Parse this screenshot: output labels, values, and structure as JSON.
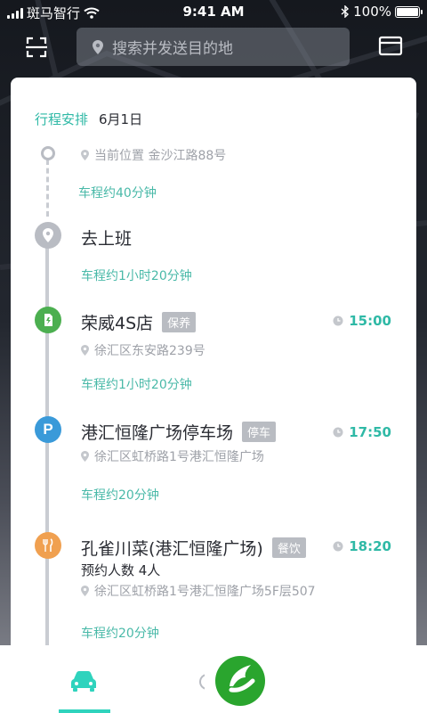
{
  "status_bar": {
    "carrier": "斑马智行",
    "time": "9:41 AM",
    "battery": "100%"
  },
  "search": {
    "placeholder": "搜索并发送目的地"
  },
  "schedule": {
    "label": "行程安排",
    "date": "6月1日",
    "start": {
      "location": "当前位置 金沙江路88号"
    },
    "travel_times": [
      "车程约40分钟",
      "车程约1小时20分钟",
      "车程约1小时20分钟",
      "车程约20分钟",
      "车程约20分钟"
    ],
    "stops": [
      {
        "name": "去上班",
        "icon": "location-pin-icon"
      },
      {
        "name": "荣威4S店",
        "tag": "保养",
        "time": "15:00",
        "address": "徐汇区东安路239号",
        "icon": "car-service-icon",
        "color": "#4caf50"
      },
      {
        "name": "港汇恒隆广场停车场",
        "tag": "停车",
        "time": "17:50",
        "address": "徐汇区虹桥路1号港汇恒隆广场",
        "icon": "parking-icon",
        "color": "#3a9ad9"
      },
      {
        "name": "孔雀川菜(港汇恒隆广场)",
        "tag": "餐饮",
        "time": "18:20",
        "reservation": "预约人数  4人",
        "address": "徐汇区虹桥路1号港汇恒隆广场5F层507",
        "icon": "restaurant-icon",
        "color": "#f0a050"
      }
    ]
  },
  "colors": {
    "accent": "#2fb9a6",
    "tab_accent": "#2fd3bd",
    "logo_green": "#2aa52e"
  },
  "tabs": [
    {
      "icon": "car-icon",
      "active": true
    }
  ]
}
